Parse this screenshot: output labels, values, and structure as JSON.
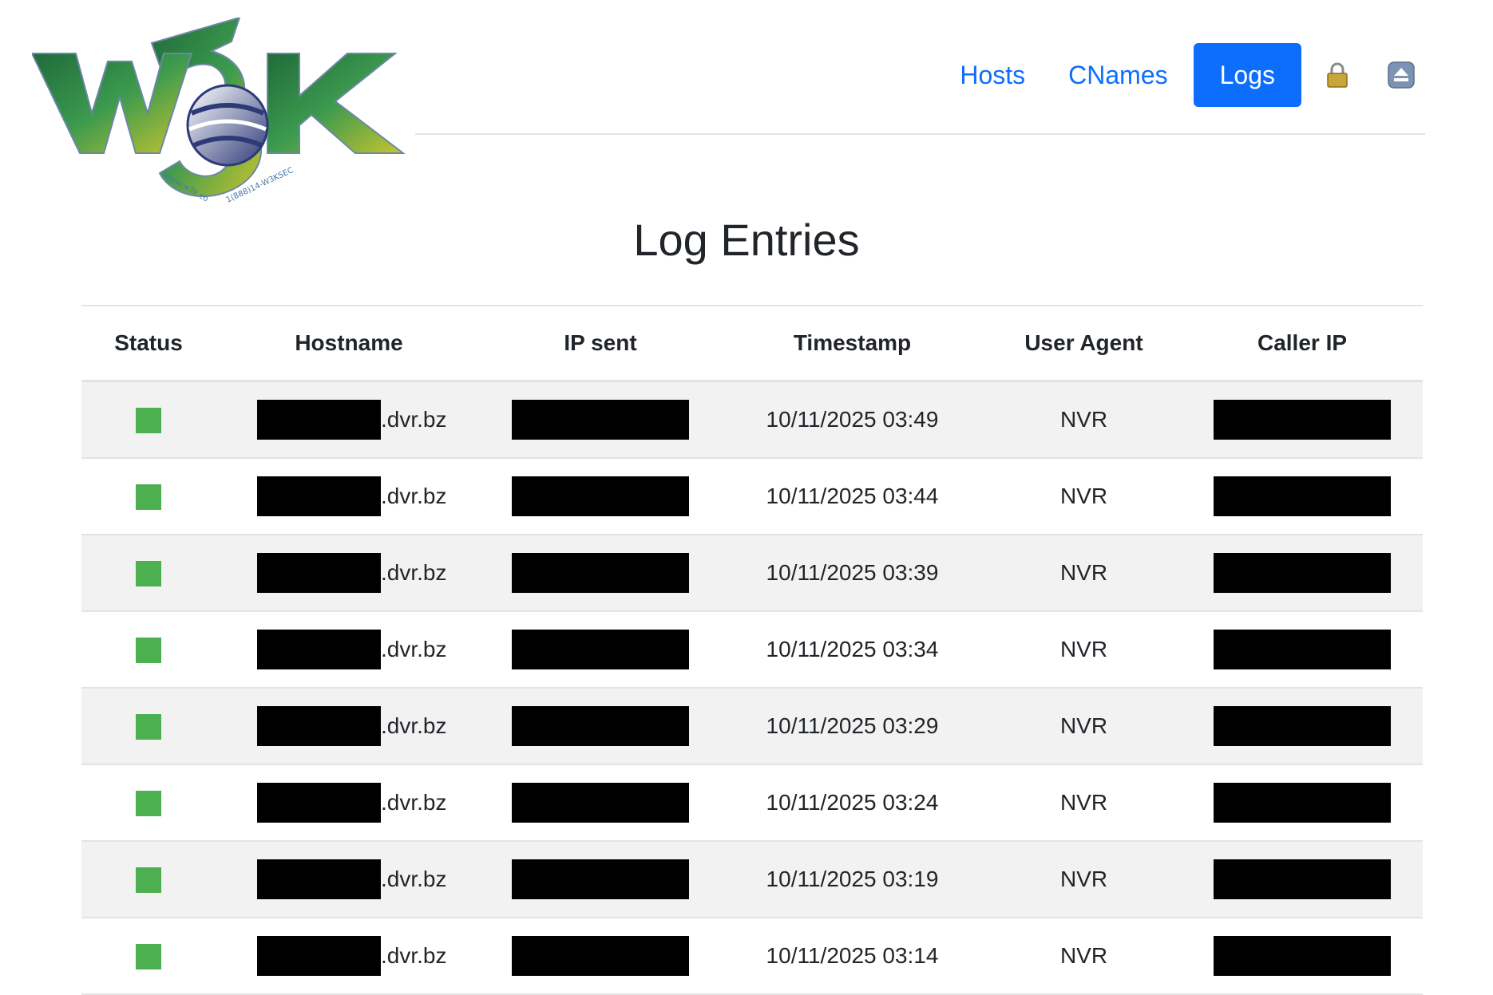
{
  "logo": {
    "text": "W3K",
    "tagline_left": "www.w3k.co",
    "tagline_right": "1(888)14-W3KSEC"
  },
  "nav": {
    "items": [
      {
        "label": "Hosts",
        "active": false
      },
      {
        "label": "CNames",
        "active": false
      },
      {
        "label": "Logs",
        "active": true
      }
    ],
    "icons": [
      "lock-icon",
      "eject-icon"
    ]
  },
  "page": {
    "title": "Log Entries"
  },
  "table": {
    "columns": [
      "Status",
      "Hostname",
      "IP sent",
      "Timestamp",
      "User Agent",
      "Caller IP"
    ],
    "rows": [
      {
        "status": "ok",
        "hostname_suffix": ".dvr.bz",
        "timestamp": "10/11/2025 03:49",
        "user_agent": "NVR"
      },
      {
        "status": "ok",
        "hostname_suffix": ".dvr.bz",
        "timestamp": "10/11/2025 03:44",
        "user_agent": "NVR"
      },
      {
        "status": "ok",
        "hostname_suffix": ".dvr.bz",
        "timestamp": "10/11/2025 03:39",
        "user_agent": "NVR"
      },
      {
        "status": "ok",
        "hostname_suffix": ".dvr.bz",
        "timestamp": "10/11/2025 03:34",
        "user_agent": "NVR"
      },
      {
        "status": "ok",
        "hostname_suffix": ".dvr.bz",
        "timestamp": "10/11/2025 03:29",
        "user_agent": "NVR"
      },
      {
        "status": "ok",
        "hostname_suffix": ".dvr.bz",
        "timestamp": "10/11/2025 03:24",
        "user_agent": "NVR"
      },
      {
        "status": "ok",
        "hostname_suffix": ".dvr.bz",
        "timestamp": "10/11/2025 03:19",
        "user_agent": "NVR"
      },
      {
        "status": "ok",
        "hostname_suffix": ".dvr.bz",
        "timestamp": "10/11/2025 03:14",
        "user_agent": "NVR"
      }
    ]
  },
  "colors": {
    "accent": "#0d6efd",
    "status_ok": "#4caf50",
    "row_stripe": "#f2f2f2",
    "redaction": "#000000"
  }
}
